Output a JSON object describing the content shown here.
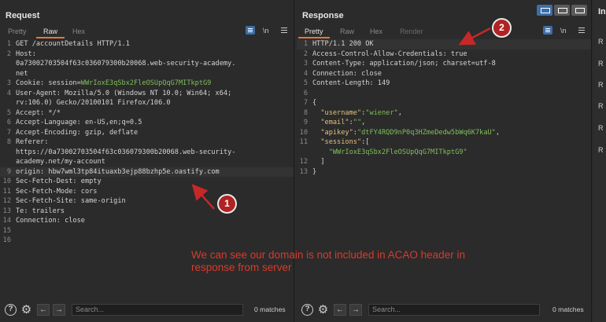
{
  "request": {
    "title": "Request",
    "tabs": [
      "Pretty",
      "Raw",
      "Hex"
    ],
    "active_tab": "Raw",
    "newline_label": "\\n",
    "lines": [
      {
        "n": "1",
        "parts": [
          {
            "t": "GET /accountDetails HTTP/1.1",
            "c": "k"
          }
        ]
      },
      {
        "n": "2",
        "parts": [
          {
            "t": "Host:",
            "c": "k"
          }
        ]
      },
      {
        "n": "",
        "parts": [
          {
            "t": "0a73002703504f63c036079300b20068.web-security-academy.",
            "c": "v"
          }
        ]
      },
      {
        "n": "",
        "parts": [
          {
            "t": "net",
            "c": "v"
          }
        ]
      },
      {
        "n": "3",
        "parts": [
          {
            "t": "Cookie: session=",
            "c": "k"
          },
          {
            "t": "WWrIoxE3qSbx2FleOSUpQqG7MITkptG9",
            "c": "g"
          }
        ]
      },
      {
        "n": "4",
        "parts": [
          {
            "t": "User-Agent: Mozilla/5.0 (Windows NT 10.0; Win64; x64;",
            "c": "k"
          }
        ]
      },
      {
        "n": "",
        "parts": [
          {
            "t": "rv:106.0) Gecko/20100101 Firefox/106.0",
            "c": "v"
          }
        ]
      },
      {
        "n": "5",
        "parts": [
          {
            "t": "Accept: */*",
            "c": "k"
          }
        ]
      },
      {
        "n": "6",
        "parts": [
          {
            "t": "Accept-Language: en-US,en;q=0.5",
            "c": "k"
          }
        ]
      },
      {
        "n": "7",
        "parts": [
          {
            "t": "Accept-Encoding: gzip, deflate",
            "c": "k"
          }
        ]
      },
      {
        "n": "8",
        "parts": [
          {
            "t": "Referer:",
            "c": "k"
          }
        ]
      },
      {
        "n": "",
        "parts": [
          {
            "t": "https://0a73002703504f63c036079300b20068.web-security-",
            "c": "v"
          }
        ]
      },
      {
        "n": "",
        "parts": [
          {
            "t": "academy.net/my-account",
            "c": "v"
          }
        ]
      },
      {
        "n": "9",
        "parts": [
          {
            "t": "origin: hbw7wml3tp84ituaxb3ejp88bzhp5e.oastify.com",
            "c": "k"
          }
        ],
        "cursor": true
      },
      {
        "n": "10",
        "parts": [
          {
            "t": "Sec-Fetch-Dest: empty",
            "c": "k"
          }
        ]
      },
      {
        "n": "11",
        "parts": [
          {
            "t": "Sec-Fetch-Mode: cors",
            "c": "k"
          }
        ]
      },
      {
        "n": "12",
        "parts": [
          {
            "t": "Sec-Fetch-Site: same-origin",
            "c": "k"
          }
        ]
      },
      {
        "n": "13",
        "parts": [
          {
            "t": "Te: trailers",
            "c": "k"
          }
        ]
      },
      {
        "n": "14",
        "parts": [
          {
            "t": "Connection: close",
            "c": "k"
          }
        ]
      },
      {
        "n": "15",
        "parts": []
      },
      {
        "n": "16",
        "parts": []
      }
    ],
    "search_placeholder": "Search...",
    "matches": "0 matches"
  },
  "response": {
    "title": "Response",
    "tabs": [
      "Pretty",
      "Raw",
      "Hex",
      "Render"
    ],
    "active_tab": "Pretty",
    "newline_label": "\\n",
    "lines": [
      {
        "n": "1",
        "parts": [
          {
            "t": "HTTP/1.1 200 OK",
            "c": "k"
          }
        ],
        "cursor": true
      },
      {
        "n": "2",
        "parts": [
          {
            "t": "Access-Control-Allow-Credentials: true",
            "c": "k"
          }
        ]
      },
      {
        "n": "3",
        "parts": [
          {
            "t": "Content-Type: application/json; charset=utf-8",
            "c": "k"
          }
        ]
      },
      {
        "n": "4",
        "parts": [
          {
            "t": "Connection: close",
            "c": "k"
          }
        ]
      },
      {
        "n": "5",
        "parts": [
          {
            "t": "Content-Length: 149",
            "c": "k"
          }
        ]
      },
      {
        "n": "6",
        "parts": []
      },
      {
        "n": "7",
        "parts": [
          {
            "t": "{",
            "c": "k"
          }
        ]
      },
      {
        "n": "8",
        "parts": [
          {
            "t": "  \"username\"",
            "c": "jkey"
          },
          {
            "t": ":",
            "c": "k"
          },
          {
            "t": "\"wiener\"",
            "c": "g"
          },
          {
            "t": ",",
            "c": "k"
          }
        ]
      },
      {
        "n": "9",
        "parts": [
          {
            "t": "  \"email\"",
            "c": "jkey"
          },
          {
            "t": ":",
            "c": "k"
          },
          {
            "t": "\"\"",
            "c": "g"
          },
          {
            "t": ",",
            "c": "k"
          }
        ]
      },
      {
        "n": "10",
        "parts": [
          {
            "t": "  \"apikey\"",
            "c": "jkey"
          },
          {
            "t": ":",
            "c": "k"
          },
          {
            "t": "\"dtFY4RQD9nP0q3HZmeDedw5bWq6K7kaU\"",
            "c": "g"
          },
          {
            "t": ",",
            "c": "k"
          }
        ]
      },
      {
        "n": "11",
        "parts": [
          {
            "t": "  \"sessions\"",
            "c": "jkey"
          },
          {
            "t": ":[",
            "c": "k"
          }
        ]
      },
      {
        "n": "",
        "parts": [
          {
            "t": "    \"WWrIoxE3qSbx2FleOSUpQqG7MITkptG9\"",
            "c": "g"
          }
        ]
      },
      {
        "n": "12",
        "parts": [
          {
            "t": "  ]",
            "c": "k"
          }
        ]
      },
      {
        "n": "13",
        "parts": [
          {
            "t": "}",
            "c": "k"
          }
        ]
      }
    ],
    "search_placeholder": "Search...",
    "matches": "0 matches"
  },
  "inspector": {
    "title": "In",
    "rows": [
      "R",
      "R",
      "R",
      "R",
      "R",
      "R"
    ]
  },
  "annotations": {
    "badge_1": "1",
    "badge_2": "2",
    "text": "We can see our domain is not included in ACAO header in response from server"
  },
  "colors": {
    "accent_tab": "#e07b39",
    "annotation_red": "#d93a2b",
    "badge_red": "#b02323",
    "string_green": "#7fbf5a"
  }
}
